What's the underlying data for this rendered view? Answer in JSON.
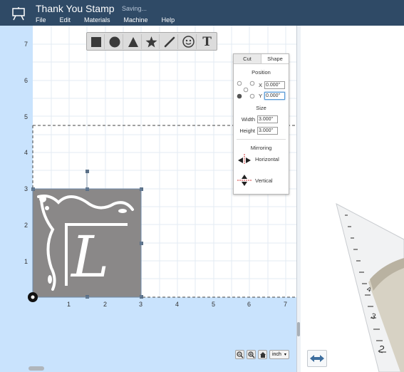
{
  "app": {
    "title": "Thank You Stamp",
    "status": "Saving...",
    "menu": [
      "File",
      "Edit",
      "Materials",
      "Machine",
      "Help"
    ]
  },
  "toolbar": {
    "tools": [
      "square-icon",
      "circle-icon",
      "triangle-icon",
      "star-icon",
      "pen-icon",
      "smiley-icon",
      "text-icon"
    ],
    "text_tool_label": "T"
  },
  "panel": {
    "tabs": [
      "Cut",
      "Shape"
    ],
    "active_tab": "Shape",
    "position": {
      "heading": "Position",
      "x_label": "X",
      "x_value": "0.000\"",
      "y_label": "Y",
      "y_value": "0.000\""
    },
    "size": {
      "heading": "Size",
      "width_label": "Width",
      "width_value": "3.000\"",
      "height_label": "Height",
      "height_value": "3.000\""
    },
    "mirroring": {
      "heading": "Mirroring",
      "horizontal_label": "Horizontal",
      "vertical_label": "Vertical"
    }
  },
  "canvas": {
    "y_ticks": [
      "7",
      "6",
      "5",
      "4",
      "3",
      "2",
      "1"
    ],
    "x_ticks": [
      "1",
      "2",
      "3",
      "4",
      "5",
      "6",
      "7"
    ],
    "design_monogram": "L"
  },
  "zoom": {
    "unit": "inch"
  },
  "preview": {
    "ruler_numbers": [
      "4",
      "3",
      "2"
    ]
  },
  "colors": {
    "topbar": "#2f4a66",
    "canvas_margin": "#c9e3fd",
    "mat": "#ffffff",
    "design_fill": "#8a8888"
  }
}
